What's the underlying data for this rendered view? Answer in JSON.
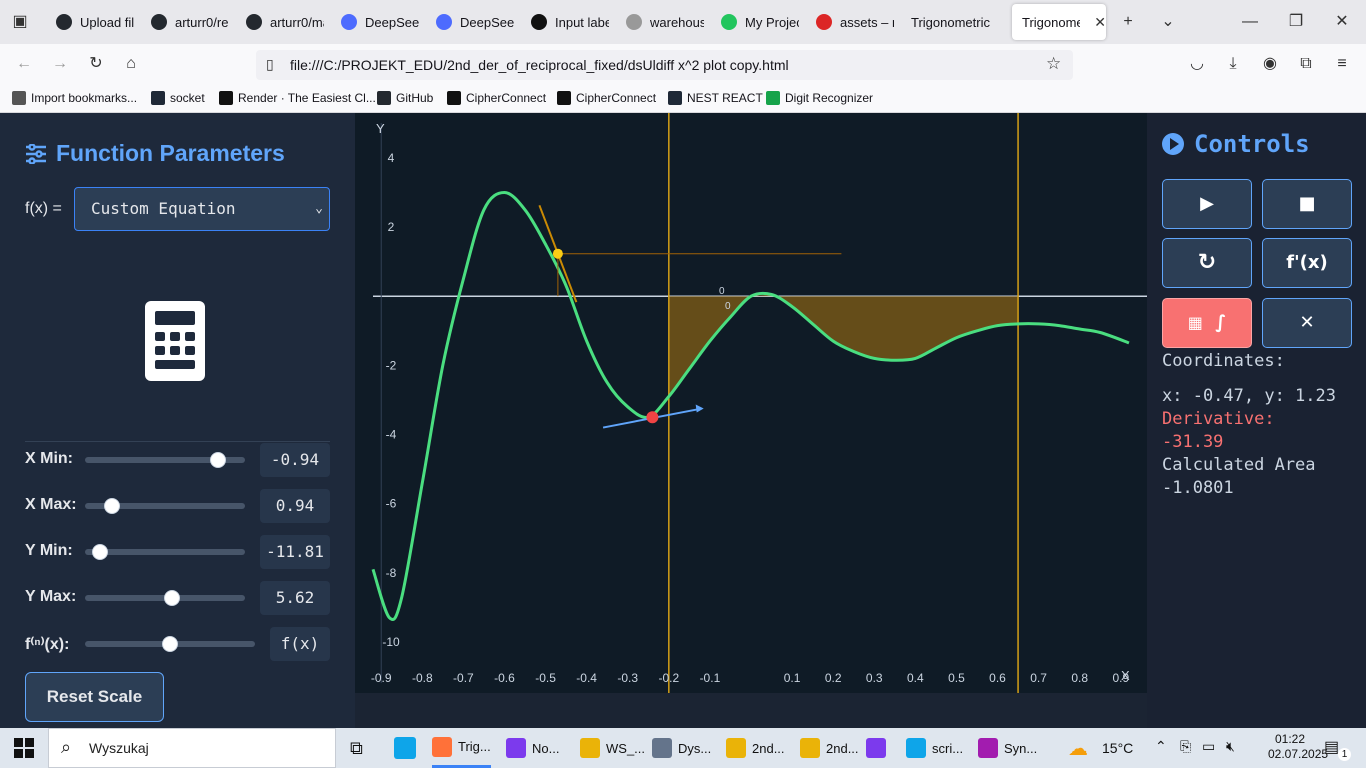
{
  "browser": {
    "tabs": [
      {
        "label": "Upload file",
        "icon": "github-icon",
        "color": "#24292f"
      },
      {
        "label": "arturr0/re",
        "icon": "github-icon",
        "color": "#24292f"
      },
      {
        "label": "arturr0/ma",
        "icon": "github-icon",
        "color": "#24292f"
      },
      {
        "label": "DeepSeek",
        "icon": "deepseek-icon",
        "color": "#4d6bfe"
      },
      {
        "label": "DeepSeek",
        "icon": "deepseek-icon",
        "color": "#4d6bfe"
      },
      {
        "label": "Input labe",
        "icon": "openai-icon",
        "color": "#111111"
      },
      {
        "label": "warehouse",
        "icon": "warehouse-icon",
        "color": "#999999"
      },
      {
        "label": "My Projec",
        "icon": "project-icon",
        "color": "#22c55e"
      },
      {
        "label": "assets – n",
        "icon": "assets-icon",
        "color": "#dc2626"
      },
      {
        "label": "Trigonometric",
        "icon": "",
        "color": ""
      },
      {
        "label": "Trigonomet",
        "icon": "",
        "color": "",
        "active": true
      }
    ],
    "url": "file:///C:/PROJEKT_EDU/2nd_der_of_reciprocal_fixed/dsUldiff x^2 plot copy.html",
    "bookmarks": [
      {
        "label": "Import bookmarks...",
        "color": "#555555"
      },
      {
        "label": "socket",
        "color": "#1f2937"
      },
      {
        "label": "Render · The Easiest Cl...",
        "color": "#111111"
      },
      {
        "label": "GitHub",
        "color": "#24292f"
      },
      {
        "label": "CipherConnect",
        "color": "#111111"
      },
      {
        "label": "CipherConnect",
        "color": "#111111"
      },
      {
        "label": "NEST REACT",
        "color": "#1f2937"
      },
      {
        "label": "Digit Recognizer",
        "color": "#16a34a"
      }
    ]
  },
  "left_panel": {
    "title": "Function Parameters",
    "fx_label": "f(x) =",
    "fx_selected": "Custom Equation",
    "sliders": [
      {
        "label": "X Min:",
        "value": "-0.94",
        "fraction": 0.87
      },
      {
        "label": "X Max:",
        "value": "0.94",
        "fraction": 0.13
      },
      {
        "label": "Y Min:",
        "value": "-11.81",
        "fraction": 0.05
      },
      {
        "label": "Y Max:",
        "value": "5.62",
        "fraction": 0.55
      },
      {
        "label": "f⁽ⁿ⁾(x):",
        "value": "f(x)",
        "fraction": 0.5
      }
    ],
    "reset_label": "Reset Scale"
  },
  "right_panel": {
    "title": "Controls",
    "buttons": [
      {
        "name": "play-button",
        "glyph": "▶"
      },
      {
        "name": "stop-button",
        "glyph": "■"
      },
      {
        "name": "reload-button",
        "glyph": "↻"
      },
      {
        "name": "fx-button",
        "glyph": "f'(x)"
      },
      {
        "name": "integral-button",
        "glyph": "∫"
      },
      {
        "name": "close-button",
        "glyph": "✕"
      }
    ],
    "coordinates_label": "Coordinates:",
    "coordinates_value": "x: -0.47, y: 1.23",
    "derivative_label": "Derivative:",
    "derivative_value": "-31.39",
    "area_label": "Calculated Area",
    "area_value": "-1.0801",
    "colors": {
      "accent": "#60a5fa",
      "derivative": "#f87171",
      "text": "#cbd5e1"
    }
  },
  "chart_data": {
    "type": "line",
    "xlabel": "X",
    "ylabel": "Y",
    "xlim": [
      -0.92,
      0.92
    ],
    "ylim": [
      -10.9,
      5.3
    ],
    "x_ticks": [
      -0.9,
      -0.8,
      -0.7,
      -0.6,
      -0.5,
      -0.4,
      -0.3,
      -0.2,
      -0.1,
      0.1,
      0.2,
      0.3,
      0.4,
      0.5,
      0.6,
      0.7,
      0.8,
      0.9
    ],
    "y_ticks": [
      4,
      2,
      -2,
      -4,
      -6,
      -8,
      -10
    ],
    "origin_labels": [
      "0",
      "0"
    ],
    "curve": {
      "color": "#4ade80",
      "points": [
        [
          -0.92,
          -7.9
        ],
        [
          -0.88,
          -9.3
        ],
        [
          -0.85,
          -8.7
        ],
        [
          -0.8,
          -5.4
        ],
        [
          -0.75,
          -2.0
        ],
        [
          -0.7,
          0.5
        ],
        [
          -0.65,
          2.5
        ],
        [
          -0.6,
          3.0
        ],
        [
          -0.55,
          2.5
        ],
        [
          -0.5,
          1.5
        ],
        [
          -0.45,
          0.3
        ],
        [
          -0.4,
          -1.3
        ],
        [
          -0.35,
          -2.5
        ],
        [
          -0.3,
          -3.2
        ],
        [
          -0.25,
          -3.5
        ],
        [
          -0.2,
          -2.9
        ],
        [
          -0.15,
          -2.1
        ],
        [
          -0.1,
          -1.3
        ],
        [
          -0.05,
          -0.6
        ],
        [
          0.0,
          0.0
        ],
        [
          0.05,
          0.05
        ],
        [
          0.1,
          -0.3
        ],
        [
          0.15,
          -0.8
        ],
        [
          0.2,
          -1.3
        ],
        [
          0.25,
          -1.6
        ],
        [
          0.3,
          -1.8
        ],
        [
          0.35,
          -1.85
        ],
        [
          0.4,
          -1.8
        ],
        [
          0.45,
          -1.5
        ],
        [
          0.5,
          -1.2
        ],
        [
          0.55,
          -1.0
        ],
        [
          0.6,
          -0.85
        ],
        [
          0.65,
          -0.8
        ],
        [
          0.7,
          -0.8
        ],
        [
          0.75,
          -0.85
        ],
        [
          0.8,
          -0.95
        ],
        [
          0.85,
          -1.05
        ],
        [
          0.92,
          -1.35
        ]
      ]
    },
    "integration_bounds": [
      -0.2,
      0.65
    ],
    "integral_area": -1.0801,
    "bound_color": "#d4a017",
    "area_color": "#7a5a17",
    "cursor_point": {
      "x": -0.47,
      "y": 1.23,
      "color": "#facc15"
    },
    "min_point": {
      "x": -0.24,
      "y": -3.5,
      "color": "#ef4444"
    },
    "tangent": {
      "x0": -0.36,
      "y0": -3.8,
      "x1": -0.12,
      "y1": -3.25,
      "color": "#60a5fa"
    }
  },
  "taskbar": {
    "search_placeholder": "Wyszukaj",
    "apps": [
      {
        "label": "Trig...",
        "color": "#ff7139",
        "running": true
      },
      {
        "label": "No...",
        "color": "#7c3aed",
        "running": false
      },
      {
        "label": "WS_...",
        "color": "#eab308",
        "running": false
      },
      {
        "label": "Dys...",
        "color": "#64748b",
        "running": false
      },
      {
        "label": "2nd...",
        "color": "#eab308",
        "running": false
      },
      {
        "label": "2nd...",
        "color": "#eab308",
        "running": false
      },
      {
        "label": "",
        "color": "#7c3aed",
        "running": false
      },
      {
        "label": "scri...",
        "color": "#0ea5e9",
        "running": false
      },
      {
        "label": "Syn...",
        "color": "#a21caf",
        "running": false
      }
    ],
    "temperature": "15°C",
    "time": "01:22",
    "date": "02.07.2025",
    "notification_count": "1"
  }
}
